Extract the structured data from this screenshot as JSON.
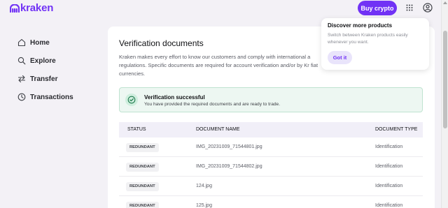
{
  "header": {
    "logo_text": "kraken",
    "buy_label": "Buy crypto",
    "grid_icon": "apps-grid-icon",
    "user_icon": "user-account-icon",
    "accent": "#7132f5"
  },
  "sidebar": {
    "items": [
      {
        "label": "Home",
        "icon": "home-icon"
      },
      {
        "label": "Explore",
        "icon": "search-icon"
      },
      {
        "label": "Transfer",
        "icon": "transfer-icon"
      },
      {
        "label": "Transactions",
        "icon": "clock-icon"
      }
    ]
  },
  "main": {
    "title": "Verification documents",
    "description": "Kraken makes every effort to know our customers and comply with international a regulations. Specific documents are required for account verification and/or by Kr fiat currencies.",
    "alert": {
      "title": "Verification successful",
      "message": "You have provided the required documents and are ready to trade.",
      "icon": "check-circle-icon"
    },
    "table": {
      "columns": [
        "STATUS",
        "DOCUMENT NAME",
        "DOCUMENT TYPE"
      ],
      "rows": [
        {
          "status": "REDUNDANT",
          "name": "IMG_20231009_71544801.jpg",
          "type": "Identification"
        },
        {
          "status": "REDUNDANT",
          "name": "IMG_20231009_71544802.jpg",
          "type": "Identification"
        },
        {
          "status": "REDUNDANT",
          "name": "124.jpg",
          "type": "Identification"
        },
        {
          "status": "REDUNDANT",
          "name": "125.jpg",
          "type": "Identification"
        }
      ]
    }
  },
  "popup": {
    "title": "Discover more products",
    "description": "Switch between Kraken products easily whenever you want.",
    "button": "Got it"
  }
}
